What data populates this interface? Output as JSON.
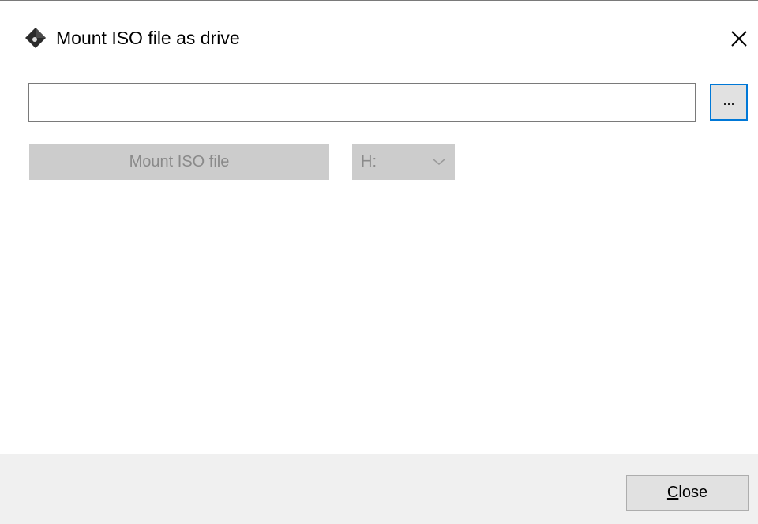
{
  "window": {
    "title": "Mount ISO file as drive",
    "icon": "disc-diamond-icon",
    "close_glyph": "✕"
  },
  "path_field": {
    "value": "",
    "placeholder": ""
  },
  "browse_button": {
    "label": "..."
  },
  "mount_button": {
    "label": "Mount ISO file",
    "enabled": false
  },
  "drive_select": {
    "selected": "H:",
    "enabled": false
  },
  "footer": {
    "close_button": {
      "mnemonic": "C",
      "rest": "lose"
    }
  },
  "colors": {
    "focus_accent": "#0078d7",
    "disabled_bg": "#cccccc",
    "disabled_text": "#8a8a8a",
    "footer_bg": "#f0f0f0"
  }
}
